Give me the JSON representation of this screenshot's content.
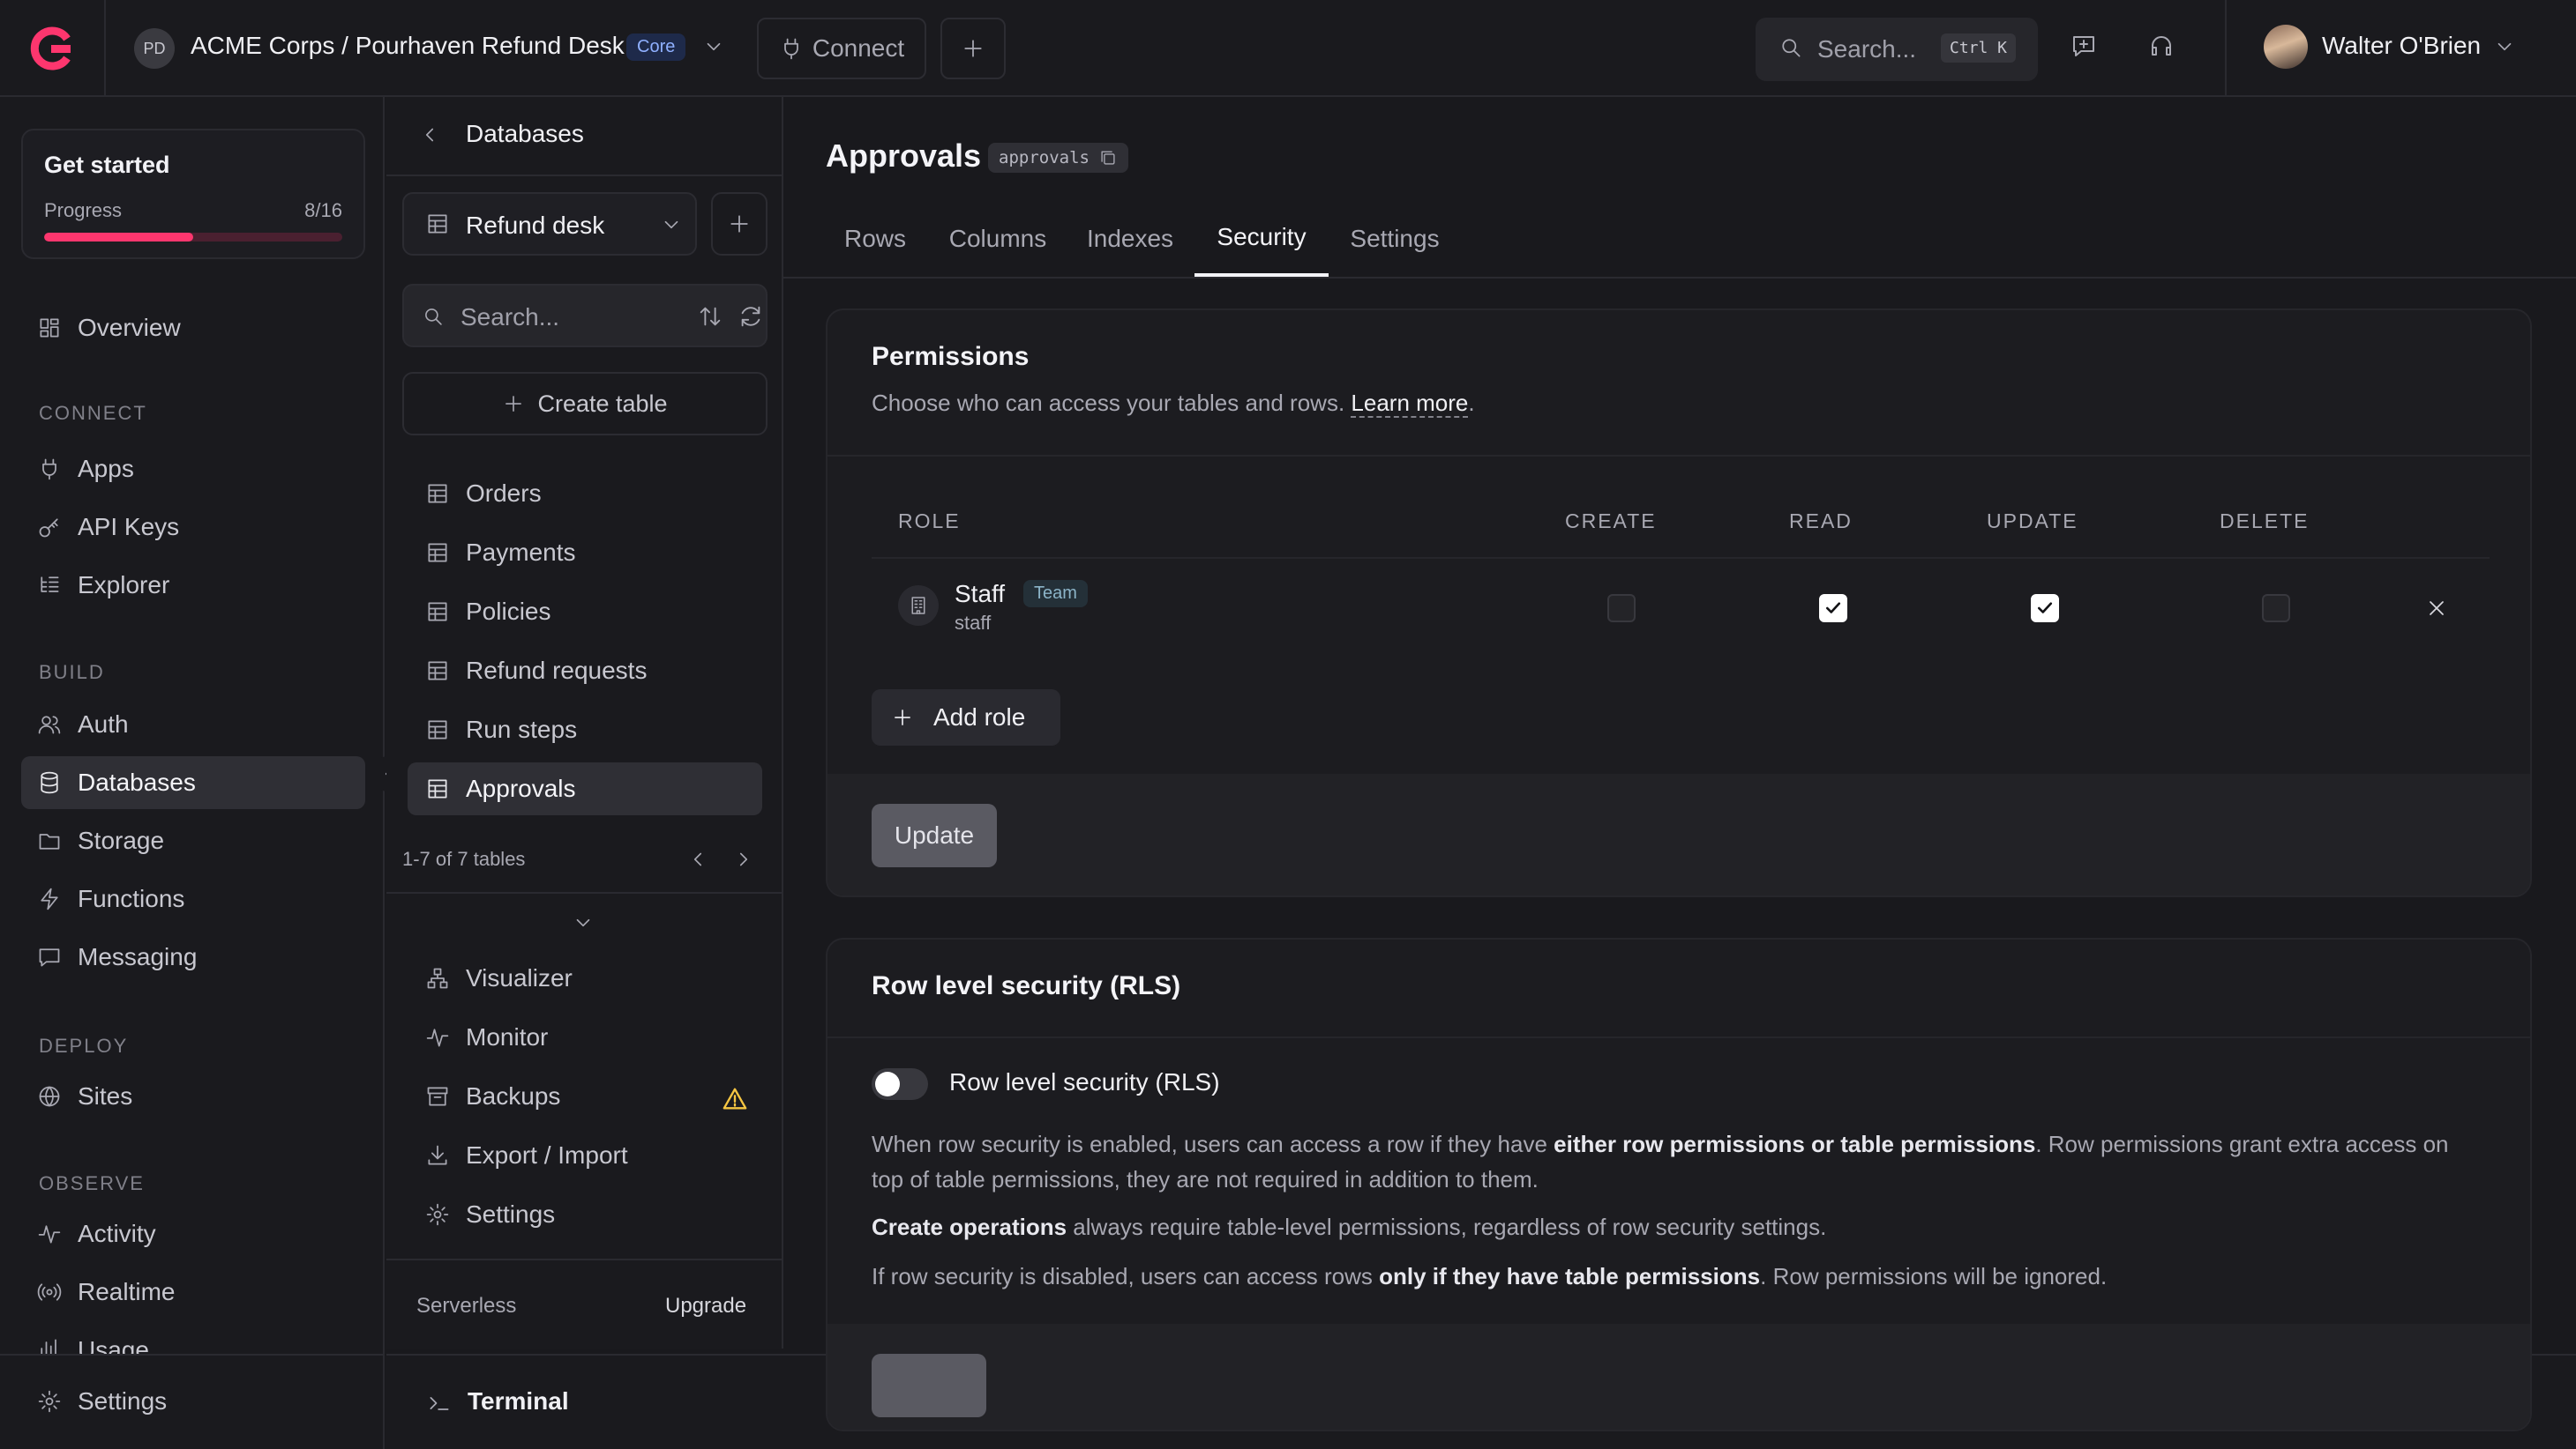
{
  "topbar": {
    "project_initials": "PD",
    "project_path": "ACME Corps / Pourhaven Refund Desk",
    "plan_badge": "Core",
    "connect_label": "Connect",
    "search_placeholder": "Search...",
    "search_shortcut": "Ctrl K",
    "user_name": "Walter O'Brien"
  },
  "get_started": {
    "title": "Get started",
    "progress_label": "Progress",
    "progress_text": "8/16",
    "progress_fraction": 0.5
  },
  "sidebar": {
    "overview": "Overview",
    "sections": {
      "connect": "CONNECT",
      "build": "BUILD",
      "deploy": "DEPLOY",
      "observe": "OBSERVE"
    },
    "connect_items": [
      "Apps",
      "API Keys",
      "Explorer"
    ],
    "build_items": [
      "Auth",
      "Databases",
      "Storage",
      "Functions",
      "Messaging"
    ],
    "deploy_items": [
      "Sites"
    ],
    "observe_items": [
      "Activity",
      "Realtime",
      "Usage"
    ],
    "settings": "Settings",
    "active_item": "Databases"
  },
  "databases_panel": {
    "back_title": "Databases",
    "selected_db": "Refund desk",
    "search_placeholder": "Search...",
    "create_table_label": "Create table",
    "tables": [
      "Orders",
      "Payments",
      "Policies",
      "Refund requests",
      "Run steps",
      "Approvals"
    ],
    "active_table": "Approvals",
    "pager_text": "1-7 of 7 tables",
    "tools": [
      "Visualizer",
      "Monitor",
      "Backups",
      "Export / Import",
      "Settings"
    ],
    "plan_label": "Serverless",
    "upgrade_label": "Upgrade"
  },
  "terminal": {
    "label": "Terminal"
  },
  "main": {
    "title": "Approvals",
    "table_id": "approvals",
    "tabs": [
      "Rows",
      "Columns",
      "Indexes",
      "Security",
      "Settings"
    ],
    "active_tab": "Security",
    "permissions": {
      "title": "Permissions",
      "description": "Choose who can access your tables and rows.",
      "learn_more": "Learn more",
      "description_end": ".",
      "columns": [
        "ROLE",
        "CREATE",
        "READ",
        "UPDATE",
        "DELETE"
      ],
      "roles": [
        {
          "name": "Staff",
          "badge": "Team",
          "id": "staff",
          "create": false,
          "read": true,
          "update": true,
          "delete": false
        }
      ],
      "add_role_label": "Add role",
      "update_label": "Update"
    },
    "rls": {
      "title": "Row level security (RLS)",
      "toggle_label": "Row level security (RLS)",
      "toggle_on": false,
      "p1_a": "When row security is enabled, users can access a row if they have ",
      "p1_b": "either row permissions or table permissions",
      "p1_c": ". Row permissions grant extra access on top of table permissions, they are not required in addition to them.",
      "p2_a": "Create operations",
      "p2_b": " always require table-level permissions, regardless of row security settings.",
      "p3_a": "If row security is disabled, users can access rows ",
      "p3_b": "only if they have table permissions",
      "p3_c": ". Row permissions will be ignored."
    }
  },
  "colors": {
    "accent": "#fd366e",
    "background": "#19191d",
    "panel": "#1a1a1e",
    "core_badge": "#8fb0ff",
    "warning": "#f5c542"
  }
}
